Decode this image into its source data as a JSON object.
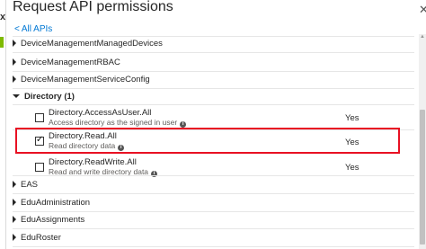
{
  "panel": {
    "title": "Request API permissions",
    "back_link": "All APIs"
  },
  "groups_before": [
    {
      "label": "DeviceManagementManagedDevices"
    },
    {
      "label": "DeviceManagementRBAC"
    },
    {
      "label": "DeviceManagementServiceConfig"
    }
  ],
  "expanded_group": {
    "label": "Directory (1)",
    "permissions": [
      {
        "name": "Directory.AccessAsUser.All",
        "description": "Access directory as the signed in user",
        "admin_consent": "Yes",
        "checked": false
      },
      {
        "name": "Directory.Read.All",
        "description": "Read directory data",
        "admin_consent": "Yes",
        "checked": true
      },
      {
        "name": "Directory.ReadWrite.All",
        "description": "Read and write directory data",
        "admin_consent": "Yes",
        "checked": false
      }
    ]
  },
  "groups_after": [
    {
      "label": "EAS"
    },
    {
      "label": "EduAdministration"
    },
    {
      "label": "EduAssignments"
    },
    {
      "label": "EduRoster"
    }
  ],
  "colors": {
    "accent": "#0078d4",
    "highlight_border": "#e81123"
  }
}
